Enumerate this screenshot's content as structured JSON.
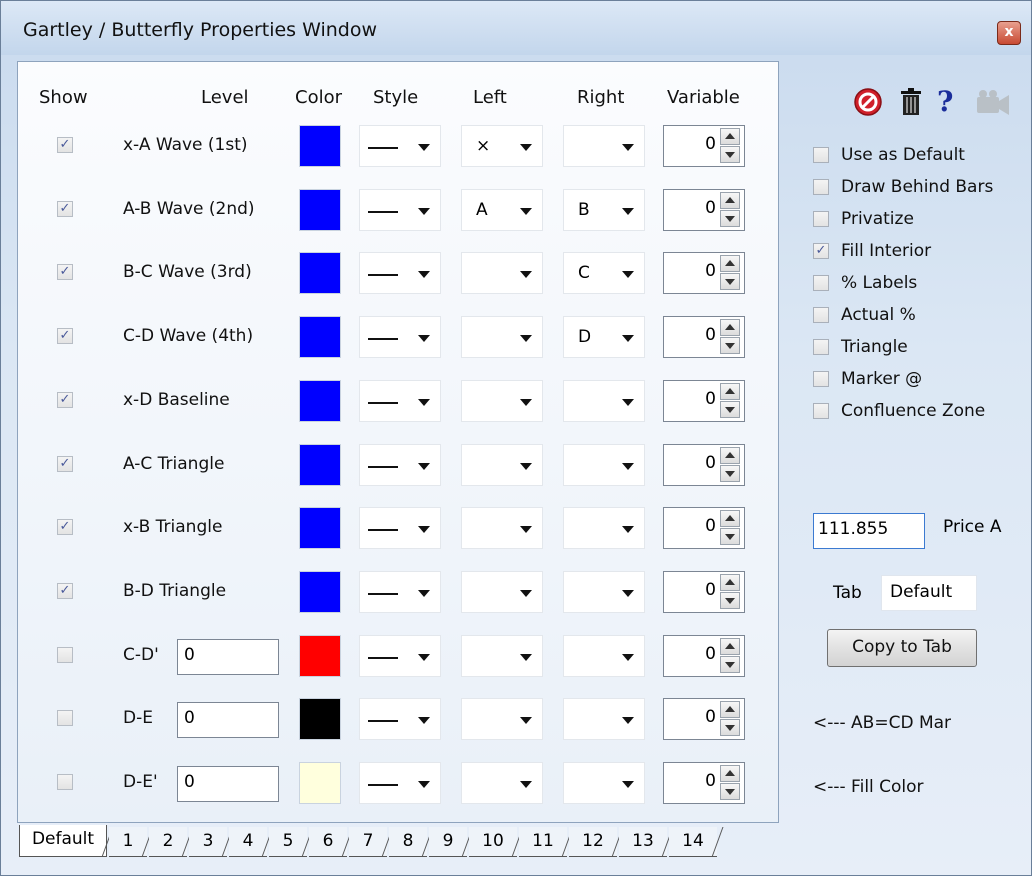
{
  "window": {
    "title": "Gartley / Butterfly Properties Window",
    "close_label": "x"
  },
  "headers": {
    "show": "Show",
    "level": "Level",
    "color": "Color",
    "style": "Style",
    "left": "Left",
    "right": "Right",
    "variable": "Variable"
  },
  "rows": [
    {
      "checked": true,
      "level": "x-A Wave (1st)",
      "color": "#0000ff",
      "left": "×",
      "right": "",
      "variable": "0"
    },
    {
      "checked": true,
      "level": "A-B Wave (2nd)",
      "color": "#0000ff",
      "left": "A",
      "right": "B",
      "variable": "0"
    },
    {
      "checked": true,
      "level": "B-C Wave (3rd)",
      "color": "#0000ff",
      "left": "",
      "right": "C",
      "variable": "0"
    },
    {
      "checked": true,
      "level": "C-D Wave (4th)",
      "color": "#0000ff",
      "left": "",
      "right": "D",
      "variable": "0"
    },
    {
      "checked": true,
      "level": "x-D Baseline",
      "color": "#0000ff",
      "left": "",
      "right": "",
      "variable": "0"
    },
    {
      "checked": true,
      "level": "A-C Triangle",
      "color": "#0000ff",
      "left": "",
      "right": "",
      "variable": "0"
    },
    {
      "checked": true,
      "level": "x-B Triangle",
      "color": "#0000ff",
      "left": "",
      "right": "",
      "variable": "0"
    },
    {
      "checked": true,
      "level": "B-D Triangle",
      "color": "#0000ff",
      "left": "",
      "right": "",
      "variable": "0"
    },
    {
      "checked": false,
      "level": "C-D'",
      "level_value": "0",
      "color": "#ff0000",
      "left": "",
      "right": "",
      "variable": "0"
    },
    {
      "checked": false,
      "level": "D-E",
      "level_value": "0",
      "color": "#000000",
      "left": "",
      "right": "",
      "variable": "0"
    },
    {
      "checked": false,
      "level": "D-E'",
      "level_value": "0",
      "color": "#ffffdd",
      "left": "",
      "right": "",
      "variable": "0"
    }
  ],
  "toolbar": {
    "icons": [
      "no-entry-icon",
      "trash-icon",
      "help-icon",
      "camera-icon"
    ],
    "help_glyph": "?"
  },
  "options": [
    {
      "label": "Use as Default",
      "checked": false
    },
    {
      "label": "Draw Behind Bars",
      "checked": false
    },
    {
      "label": "Privatize",
      "checked": false
    },
    {
      "label": "Fill Interior",
      "checked": true
    },
    {
      "label": "% Labels",
      "checked": false
    },
    {
      "label": "Actual %",
      "checked": false
    },
    {
      "label": "Triangle",
      "checked": false
    },
    {
      "label": "Marker @",
      "checked": false
    },
    {
      "label": "Confluence Zone",
      "checked": false
    }
  ],
  "price": {
    "value": "111.855",
    "label": "Price A"
  },
  "tab_field": {
    "label": "Tab",
    "value": "Default"
  },
  "copy_button": "Copy to Tab",
  "notes": {
    "abcd": "<--- AB=CD Mar",
    "fill": "<--- Fill Color"
  },
  "tabs": [
    "Default",
    "1",
    "2",
    "3",
    "4",
    "5",
    "6",
    "7",
    "8",
    "9",
    "10",
    "11",
    "12",
    "13",
    "14"
  ],
  "check_glyph": "✓"
}
